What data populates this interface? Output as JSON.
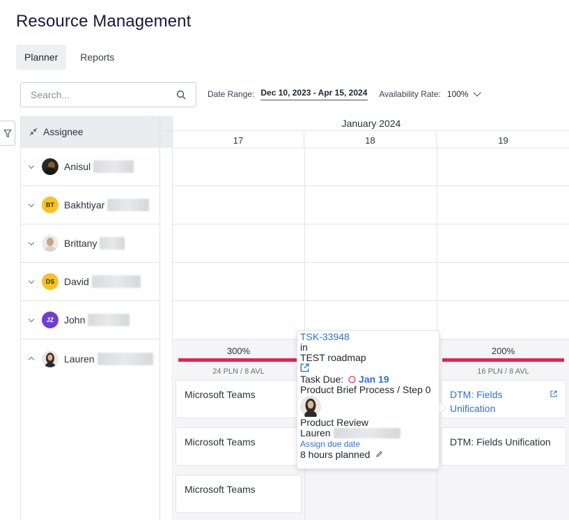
{
  "page": {
    "title": "Resource Management"
  },
  "tabs": [
    {
      "label": "Planner"
    },
    {
      "label": "Reports"
    }
  ],
  "search": {
    "placeholder": "Search..."
  },
  "filters": {
    "date_range_label": "Date Range:",
    "date_range_value": "Dec 10, 2023 - Apr 15, 2024",
    "availability_label": "Availability Rate:",
    "availability_value": "100%"
  },
  "grid": {
    "assignee_header": "Assignee",
    "month": "January 2024",
    "days": [
      "17",
      "18",
      "19"
    ]
  },
  "assignees": [
    {
      "first_name": "Anisul",
      "initials": "",
      "avatar": "photo-dark"
    },
    {
      "first_name": "Bakhtiyar",
      "initials": "BT",
      "avatar": "yellow"
    },
    {
      "first_name": "Brittany",
      "initials": "",
      "avatar": "photo-light"
    },
    {
      "first_name": "David",
      "initials": "DS",
      "avatar": "yellow"
    },
    {
      "first_name": "John",
      "initials": "JZ",
      "avatar": "purple"
    },
    {
      "first_name": "Lauren",
      "initials": "",
      "avatar": "photo-lauren"
    }
  ],
  "lauren_days": [
    {
      "utilization": "300%",
      "summary": "24 PLN / 8 AVL",
      "cards": [
        "Microsoft Teams",
        "Microsoft Teams",
        "Microsoft Teams"
      ]
    },
    {
      "utilization": "200%",
      "summary": "16 PLN / 8 AVL",
      "cards": [
        "DTM: Fields Unification",
        "DTM: Fields Unification"
      ]
    }
  ],
  "popover": {
    "task_id": "TSK-33948",
    "in_text": "in",
    "project": "TEST roadmap",
    "due_label": "Task Due:",
    "due_date": "Jan 19",
    "process": "Product Brief Process / Step 0",
    "task_name": "Product Review",
    "assignee": "Lauren",
    "assign_link": "Assign due date",
    "planned": "8 hours planned"
  },
  "colors": {
    "overallocated": "#e6244e",
    "link": "#2f6fd6",
    "accent_yellow": "#f6c325",
    "accent_purple": "#6e3fd0"
  }
}
